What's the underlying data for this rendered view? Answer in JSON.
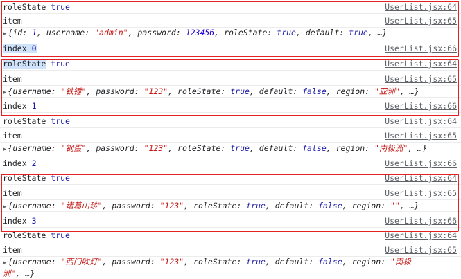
{
  "source_link": "UserList.jsx:64",
  "source_link_item": "UserList.jsx:65",
  "source_link_index": "UserList.jsx:66",
  "rows": [
    {
      "label": "roleState",
      "value": "true"
    },
    {
      "label": "item"
    },
    {
      "obj": {
        "k1": "{id:",
        "v1": "1",
        "k2": ", username:",
        "v2": "\"admin\"",
        "k3": ", password:",
        "v3": "123456",
        "k4": ", roleState:",
        "v4": "true",
        "k5": ", default:",
        "v5": "true",
        "tail": ", …}"
      }
    },
    {
      "label": "index",
      "value": "0"
    },
    {
      "label": "roleState",
      "value": "true"
    },
    {
      "label": "item"
    },
    {
      "obj": {
        "k1": "{username:",
        "v1": "\"铁锤\"",
        "k2": ", password:",
        "v2": "\"123\"",
        "k3": ", roleState:",
        "v3": "true",
        "k4": ", default:",
        "v4": "false",
        "k5": ", region:",
        "v5": "\"亚洲\"",
        "tail": ", …}"
      }
    },
    {
      "label": "index",
      "value": "1"
    },
    {
      "label": "roleState",
      "value": "true"
    },
    {
      "label": "item"
    },
    {
      "obj": {
        "k1": "{username:",
        "v1": "\"钢蛋\"",
        "k2": ", password:",
        "v2": "\"123\"",
        "k3": ", roleState:",
        "v3": "true",
        "k4": ", default:",
        "v4": "false",
        "k5": ", region:",
        "v5": "\"南极洲\"",
        "tail": ", …}"
      }
    },
    {
      "label": "index",
      "value": "2"
    },
    {
      "label": "roleState",
      "value": "true"
    },
    {
      "label": "item"
    },
    {
      "obj": {
        "k1": "{username:",
        "v1": "\"诸葛山珍\"",
        "k2": ", password:",
        "v2": "\"123\"",
        "k3": ", roleState:",
        "v3": "true",
        "k4": ", default:",
        "v4": "false",
        "k5": ", region:",
        "v5": "\"\"",
        "tail": ", …}"
      }
    },
    {
      "label": "index",
      "value": "3"
    },
    {
      "label": "roleState",
      "value": "true"
    },
    {
      "label": "item"
    },
    {
      "obj": {
        "k1": "{username:",
        "v1": "\"西门吹灯\"",
        "k2": ", password:",
        "v2": "\"123\"",
        "k3": ", roleState:",
        "v3": "true",
        "k4": ", default:",
        "v4": "false",
        "k5": ", region:",
        "v5a": "\"南极",
        "v5b": "洲\"",
        "tail": ", …}"
      }
    }
  ]
}
